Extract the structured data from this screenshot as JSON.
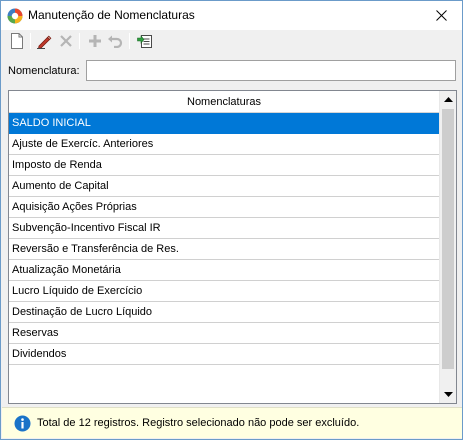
{
  "window": {
    "title": "Manutenção de Nomenclaturas"
  },
  "titlebar": {
    "app_icon": "app-logo-icon",
    "close_glyph": "✕"
  },
  "toolbar": {
    "buttons": [
      {
        "name": "new-document-icon",
        "enabled": true
      },
      {
        "name": "edit-pencil-icon",
        "enabled": true
      },
      {
        "name": "delete-x-icon",
        "enabled": false
      },
      {
        "name": "add-plus-icon",
        "enabled": false
      },
      {
        "name": "undo-icon",
        "enabled": false
      },
      {
        "name": "export-icon",
        "enabled": true
      }
    ]
  },
  "search": {
    "label": "Nomenclatura:",
    "value": ""
  },
  "grid": {
    "column_header": "Nomenclaturas",
    "rows": [
      "SALDO INICIAL",
      "Ajuste de Exercíc. Anteriores",
      "Imposto de Renda",
      "Aumento de Capital",
      "Aquisição Ações Próprias",
      "Subvenção-Incentivo Fiscal IR",
      "Reversão e Transferência de Res.",
      "Atualização Monetária",
      "Lucro Líquido de Exercício",
      "Destinação de Lucro Líquido",
      "Reservas",
      "Dividendos"
    ],
    "selected_index": 0
  },
  "status": {
    "icon": "info-icon",
    "text": "Total de 12 registros. Registro selecionado não pode ser excluído."
  },
  "colors": {
    "selection": "#0078d7",
    "status_background": "#ffffe1",
    "info_icon": "#1a73c8"
  }
}
